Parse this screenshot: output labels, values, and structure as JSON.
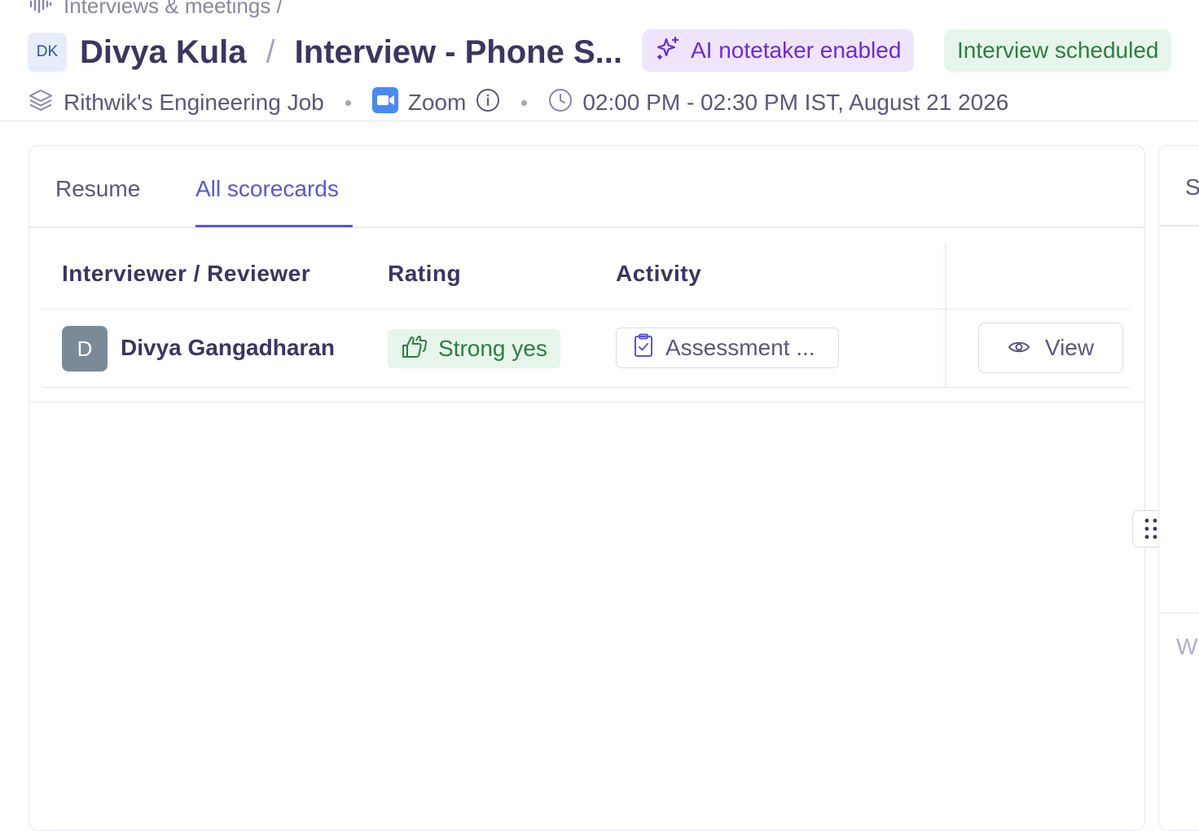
{
  "breadcrumb": {
    "text": "Interviews & meetings /"
  },
  "candidate": {
    "initials": "DK",
    "name": "Divya Kula"
  },
  "title": {
    "separator": "/",
    "interview": "Interview - Phone S..."
  },
  "badges": {
    "ai_notetaker": "AI notetaker enabled",
    "status": "Interview scheduled"
  },
  "meta": {
    "job": "Rithwik's Engineering Job",
    "platform": "Zoom",
    "time": "02:00 PM - 02:30 PM IST, August 21 2026"
  },
  "tabs": [
    {
      "label": "Resume",
      "active": false
    },
    {
      "label": "All scorecards",
      "active": true
    }
  ],
  "table": {
    "headers": [
      "Interviewer / Reviewer",
      "Rating",
      "Activity"
    ],
    "rows": [
      {
        "initial": "D",
        "reviewer": "Divya Gangadharan",
        "rating": "Strong yes",
        "activity": "Assessment ...",
        "action": "View"
      }
    ]
  },
  "right_panel": {
    "tab_partial": "S",
    "text_partial": "W"
  },
  "colors": {
    "accent": "#5b54e0",
    "ai_badge_bg": "#efe5fd",
    "ai_badge_text": "#6a2bd9",
    "success_bg": "#e7f6ea",
    "success_text": "#2e7d43",
    "zoom_blue": "#4a8af4"
  },
  "icons": {
    "breadcrumb": "waveform-icon",
    "ai": "sparkle-icon",
    "job": "layers-icon",
    "platform": "zoom-icon",
    "info": "info-icon",
    "time": "clock-icon",
    "rating": "thumbs-up-icon",
    "activity": "clipboard-check-icon",
    "view": "eye-icon",
    "handle": "drag-handle-icon"
  }
}
